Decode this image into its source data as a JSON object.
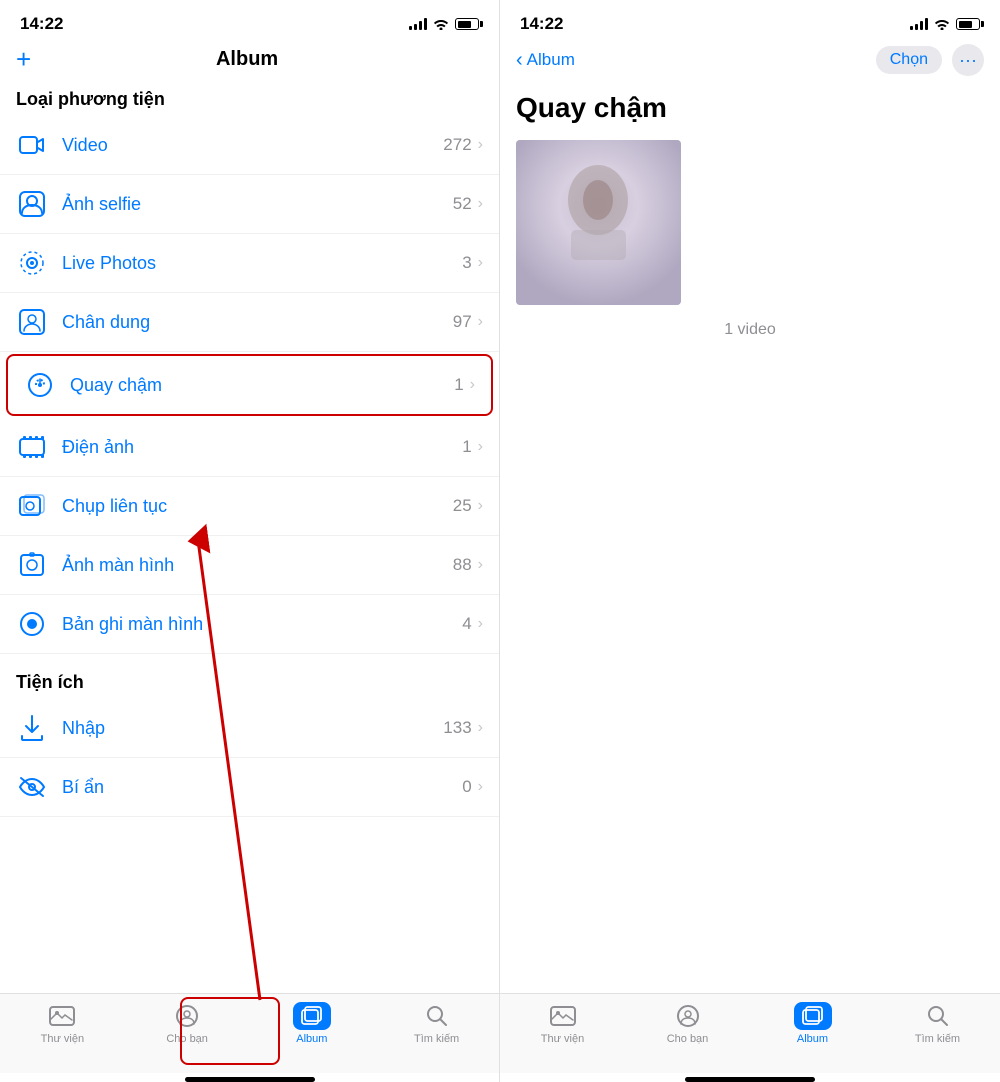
{
  "left": {
    "status": {
      "time": "14:22"
    },
    "nav": {
      "add_label": "+",
      "title": "Album"
    },
    "section_media_type": "Loại phương tiện",
    "items": [
      {
        "id": "video",
        "label": "Video",
        "count": "272",
        "icon": "video"
      },
      {
        "id": "selfie",
        "label": "Ảnh selfie",
        "count": "52",
        "icon": "selfie"
      },
      {
        "id": "live",
        "label": "Live Photos",
        "count": "3",
        "icon": "live"
      },
      {
        "id": "portrait",
        "label": "Chân dung",
        "count": "97",
        "icon": "portrait"
      },
      {
        "id": "slowmo",
        "label": "Quay chậm",
        "count": "1",
        "icon": "slowmo",
        "highlighted": true
      },
      {
        "id": "cinematic",
        "label": "Điện ảnh",
        "count": "1",
        "icon": "cinematic"
      },
      {
        "id": "burst",
        "label": "Chụp liên tục",
        "count": "25",
        "icon": "burst"
      },
      {
        "id": "screenshot",
        "label": "Ảnh màn hình",
        "count": "88",
        "icon": "screenshot"
      },
      {
        "id": "screenrecord",
        "label": "Bản ghi màn hình",
        "count": "4",
        "icon": "screenrecord"
      }
    ],
    "section_utility": "Tiện ích",
    "utility_items": [
      {
        "id": "import",
        "label": "Nhập",
        "count": "133",
        "icon": "import"
      },
      {
        "id": "hidden",
        "label": "Bí ẩn",
        "count": "0",
        "icon": "hidden"
      }
    ],
    "tabs": [
      {
        "id": "library",
        "label": "Thư viện",
        "active": false
      },
      {
        "id": "foryou",
        "label": "Cho bạn",
        "active": false
      },
      {
        "id": "album",
        "label": "Album",
        "active": true
      },
      {
        "id": "search",
        "label": "Tìm kiếm",
        "active": false
      }
    ]
  },
  "right": {
    "status": {
      "time": "14:22"
    },
    "nav": {
      "back_label": "Album",
      "chon_label": "Chọn",
      "dots_label": "···"
    },
    "page_title": "Quay chậm",
    "video_count": "1 video",
    "tabs": [
      {
        "id": "library",
        "label": "Thư viện",
        "active": false
      },
      {
        "id": "foryou",
        "label": "Cho bạn",
        "active": false
      },
      {
        "id": "album",
        "label": "Album",
        "active": true
      },
      {
        "id": "search",
        "label": "Tìm kiếm",
        "active": false
      }
    ]
  }
}
